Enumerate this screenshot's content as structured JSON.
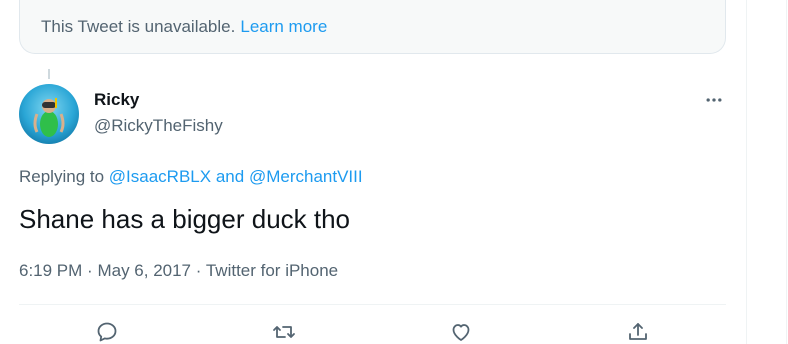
{
  "unavailable": {
    "message": "This Tweet is unavailable.",
    "link": "Learn more"
  },
  "tweet": {
    "author": {
      "display_name": "Ricky",
      "handle": "@RickyTheFishy"
    },
    "replying_to": {
      "prefix": "Replying to",
      "mention_1": "@IsaacRBLX",
      "conjunction": "and",
      "mention_2": "@MerchantVIII"
    },
    "text": "Shane has a bigger duck tho",
    "time": "6:19 PM",
    "date": "May 6, 2017",
    "source": "Twitter for iPhone",
    "separator": "·"
  },
  "icons": {
    "more": "more-horizontal-icon",
    "reply": "reply-icon",
    "retweet": "retweet-icon",
    "like": "heart-icon",
    "share": "share-icon"
  },
  "colors": {
    "accent": "#1d9bf0",
    "secondary_text": "#536471",
    "primary_text": "#0f1419"
  }
}
